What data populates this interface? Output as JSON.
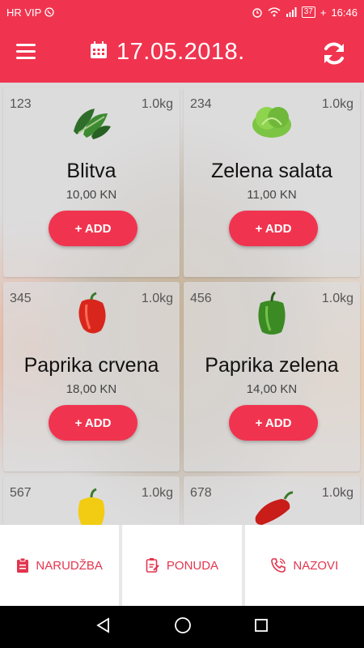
{
  "status_bar": {
    "carrier": "HR VIP",
    "battery": "37",
    "time": "16:46"
  },
  "header": {
    "date": "17.05.2018."
  },
  "products": [
    {
      "code": "123",
      "weight": "1.0kg",
      "name": "Blitva",
      "price": "10,00 KN",
      "add_label": "+ ADD",
      "icon": "chard-icon"
    },
    {
      "code": "234",
      "weight": "1.0kg",
      "name": "Zelena salata",
      "price": "11,00 KN",
      "add_label": "+ ADD",
      "icon": "lettuce-icon"
    },
    {
      "code": "345",
      "weight": "1.0kg",
      "name": "Paprika crvena",
      "price": "18,00 KN",
      "add_label": "+ ADD",
      "icon": "red-pepper-icon"
    },
    {
      "code": "456",
      "weight": "1.0kg",
      "name": "Paprika zelena",
      "price": "14,00 KN",
      "add_label": "+ ADD",
      "icon": "green-pepper-icon"
    },
    {
      "code": "567",
      "weight": "1.0kg",
      "icon": "yellow-pepper-icon"
    },
    {
      "code": "678",
      "weight": "1.0kg",
      "icon": "red-chili-pepper-icon"
    }
  ],
  "bottom_nav": {
    "order_label": "NARUDŽBA",
    "offer_label": "PONUDA",
    "call_label": "NAZOVI"
  },
  "colors": {
    "primary": "#f0344f",
    "accent_text": "#e3354e"
  }
}
